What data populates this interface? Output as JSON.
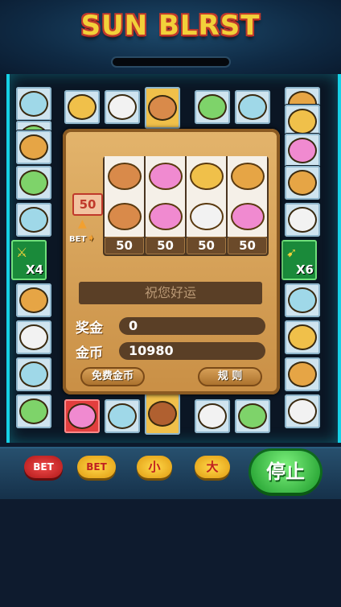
{
  "title": "SUN BLRST",
  "ring_left": [
    "owl",
    "wolf",
    "monkey",
    "wolf",
    "owl",
    "monkey",
    "ram",
    "owl",
    "wolf"
  ],
  "ring_top": [
    "lion",
    "ram",
    "hero",
    "wolf",
    "owl"
  ],
  "ring_right": [
    "monkey",
    "lion",
    "elephant",
    "monkey",
    "ram",
    "owl",
    "lion",
    "monkey",
    "ram"
  ],
  "ring_bottom": [
    "elephant",
    "owl",
    "volcano",
    "ram",
    "wolf"
  ],
  "multipliers": {
    "left": "X4",
    "right": "X6"
  },
  "reels": [
    [
      "hero",
      "hero",
      "hero"
    ],
    [
      "elephant",
      "elephant",
      "elephant"
    ],
    [
      "lion",
      "lion",
      "ram"
    ],
    [
      "monkey",
      "monkey",
      "elephant"
    ]
  ],
  "reel_bets": [
    "50",
    "50",
    "50",
    "50"
  ],
  "bet_value": "50",
  "bet_label": "BET",
  "message": "祝您好运",
  "prize_label": "奖金",
  "prize_value": "0",
  "coins_label": "金币",
  "coins_value": "10980",
  "free_coins_button": "免费金币",
  "rules_button": "规 则",
  "controls": {
    "bet_red": "BET",
    "bet_yellow": "BET",
    "small": "小",
    "big": "大",
    "stop": "停止"
  },
  "colors": {
    "accent": "#16d0e6",
    "highlight": "#e23e3e",
    "stop": "#1c9a2a"
  }
}
